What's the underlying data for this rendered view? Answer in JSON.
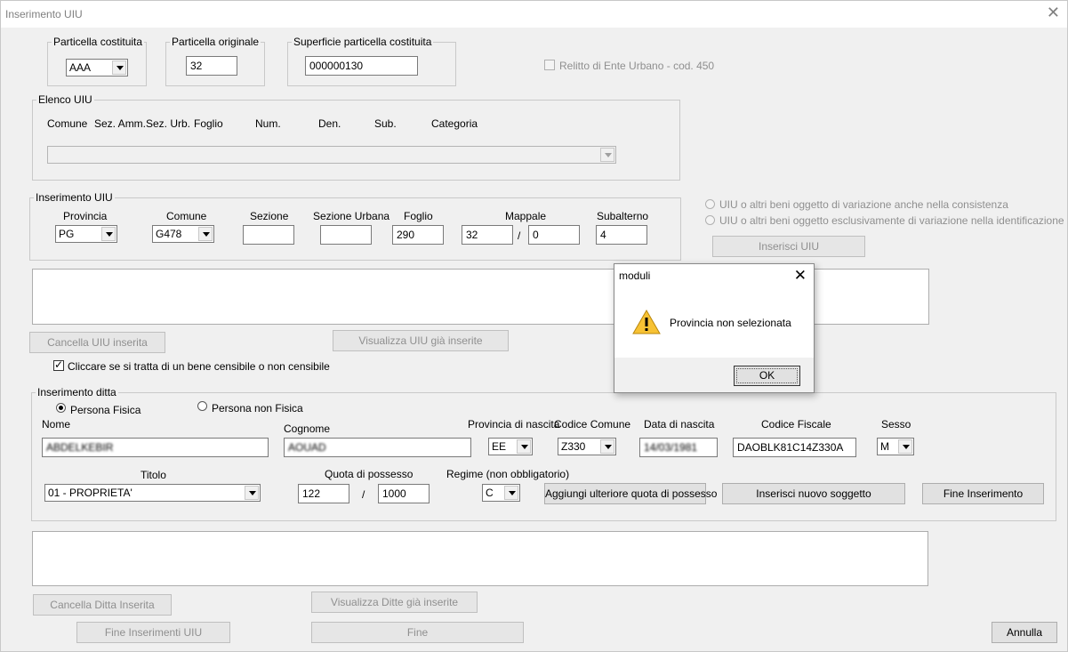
{
  "window": {
    "title": "Inserimento UIU",
    "close_glyph": "✕"
  },
  "particella_costituita": {
    "legend": "Particella costituita",
    "value": "AAA"
  },
  "particella_originale": {
    "legend": "Particella originale",
    "value": "32"
  },
  "superficie": {
    "legend": "Superficie particella costituita",
    "value": "000000130"
  },
  "relitto_label": "Relitto di Ente Urbano - cod. 450",
  "elenco_uiu": {
    "legend": "Elenco UIU",
    "columns": [
      "Comune",
      "Sez. Amm.",
      "Sez. Urb.",
      "Foglio",
      "Num.",
      "Den.",
      "Sub.",
      "Categoria"
    ]
  },
  "inserimento_uiu": {
    "legend": "Inserimento UIU",
    "labels": {
      "provincia": "Provincia",
      "comune": "Comune",
      "sezione": "Sezione",
      "sezione_urbana": "Sezione Urbana",
      "foglio": "Foglio",
      "mappale": "Mappale",
      "subalterno": "Subalterno"
    },
    "values": {
      "provincia": "PG",
      "comune": "G478",
      "sezione": "",
      "sezione_urbana": "",
      "foglio": "290",
      "mappale1": "32",
      "mappale2": "0",
      "subalterno": "4"
    },
    "slash": "/"
  },
  "variazione": {
    "option1": "UIU o altri beni oggetto di variazione anche nella consistenza",
    "option2": "UIU o altri beni oggetto esclusivamente di variazione nella identificazione",
    "inserisci_uiu": "Inserisci UIU"
  },
  "buttons": {
    "cancella_uiu": "Cancella UIU inserita",
    "visualizza_uiu": "Visualizza UIU già inserite",
    "cancella_ditta": "Cancella Ditta Inserita",
    "visualizza_ditte": "Visualizza Ditte già inserite",
    "fine_inserimenti_uiu": "Fine Inserimenti UIU",
    "fine": "Fine",
    "annulla": "Annulla"
  },
  "bene_censibile_label": "Cliccare se si tratta di un bene censibile o non censibile",
  "ditta": {
    "legend": "Inserimento ditta",
    "persona_fisica": "Persona Fisica",
    "persona_non_fisica": "Persona non Fisica",
    "labels": {
      "nome": "Nome",
      "cognome": "Cognome",
      "provincia_nascita": "Provincia di nascita",
      "codice_comune": "Codice Comune",
      "data_nascita": "Data di nascita",
      "codice_fiscale": "Codice Fiscale",
      "sesso": "Sesso",
      "titolo": "Titolo",
      "quota": "Quota di possesso",
      "regime": "Regime (non obbligatorio)"
    },
    "values": {
      "nome": "ABDELKEBIR",
      "cognome": "AOUAD",
      "provincia_nascita": "EE",
      "codice_comune": "Z330",
      "data_nascita": "14/03/1981",
      "codice_fiscale": "DAOBLK81C14Z330A",
      "sesso": "M",
      "titolo": "01 - PROPRIETA'",
      "quota_num": "122",
      "quota_den": "1000",
      "regime": "C"
    },
    "slash": "/",
    "aggiungi": "Aggiungi ulteriore quota di possesso",
    "inserisci_soggetto": "Inserisci nuovo soggetto",
    "fine_inserimento": "Fine Inserimento"
  },
  "dialog": {
    "title": "moduli",
    "message": "Provincia non selezionata",
    "ok": "OK",
    "close_glyph": "✕"
  }
}
